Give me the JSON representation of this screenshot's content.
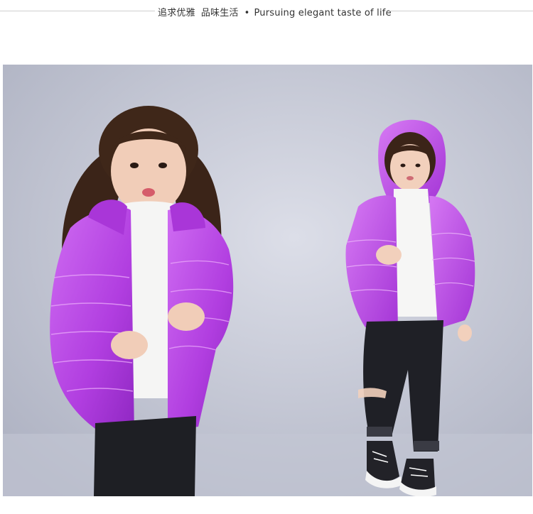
{
  "header": {
    "tagline_zh_1": "追求优雅",
    "tagline_zh_2": "品味生活",
    "bullet": "•",
    "tagline_en": "Pursuing elegant taste of life"
  },
  "photo": {
    "subject": "two girls in hooded puffer jackets",
    "jacket_color": "#b13ee0",
    "background_color": "#c9ccd8"
  }
}
